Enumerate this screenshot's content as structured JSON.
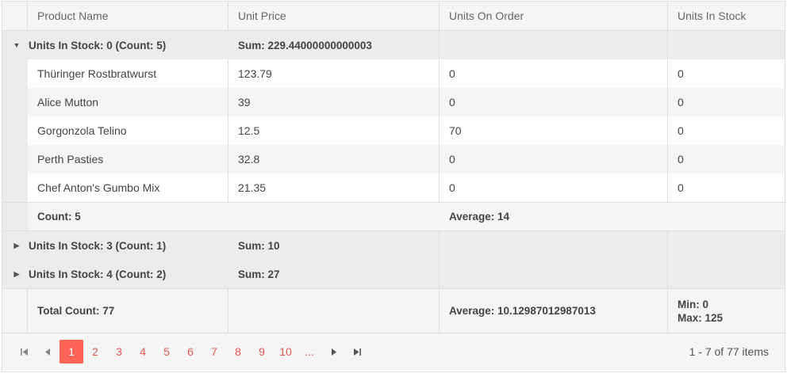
{
  "columns": {
    "product_name": "Product Name",
    "unit_price": "Unit Price",
    "units_on_order": "Units On Order",
    "units_in_stock": "Units In Stock"
  },
  "groups": [
    {
      "title": "Units In Stock: 0 (Count: 5)",
      "sum": "Sum: 229.44000000000003",
      "expanded": true,
      "rows": [
        {
          "name": "Thüringer Rostbratwurst",
          "price": "123.79",
          "on_order": "0",
          "in_stock": "0"
        },
        {
          "name": "Alice Mutton",
          "price": "39",
          "on_order": "0",
          "in_stock": "0"
        },
        {
          "name": "Gorgonzola Telino",
          "price": "12.5",
          "on_order": "70",
          "in_stock": "0"
        },
        {
          "name": "Perth Pasties",
          "price": "32.8",
          "on_order": "0",
          "in_stock": "0"
        },
        {
          "name": "Chef Anton's Gumbo Mix",
          "price": "21.35",
          "on_order": "0",
          "in_stock": "0"
        }
      ],
      "footer_count": "Count: 5",
      "footer_average": "Average: 14"
    },
    {
      "title": "Units In Stock: 3 (Count: 1)",
      "sum": "Sum: 10",
      "expanded": false
    },
    {
      "title": "Units In Stock: 4 (Count: 2)",
      "sum": "Sum: 27",
      "expanded": false
    }
  ],
  "footer": {
    "total_count": "Total Count: 77",
    "average": "Average: 10.12987012987013",
    "min": "Min: 0",
    "max": "Max: 125"
  },
  "pager": {
    "pages": [
      "1",
      "2",
      "3",
      "4",
      "5",
      "6",
      "7",
      "8",
      "9",
      "10",
      "..."
    ],
    "active_page": "1",
    "info": "1 - 7 of 77 items",
    "icons": {
      "first": "first-page-icon",
      "prev": "prev-page-icon",
      "next": "next-page-icon",
      "last": "last-page-icon"
    }
  },
  "colors": {
    "accent": "#ff6358",
    "link": "#e8574f",
    "group_bg": "#ececec",
    "alt_bg": "#f5f5f5",
    "border": "#dedede"
  },
  "icons": {
    "expanded": "caret-down-icon",
    "collapsed": "caret-right-icon"
  }
}
